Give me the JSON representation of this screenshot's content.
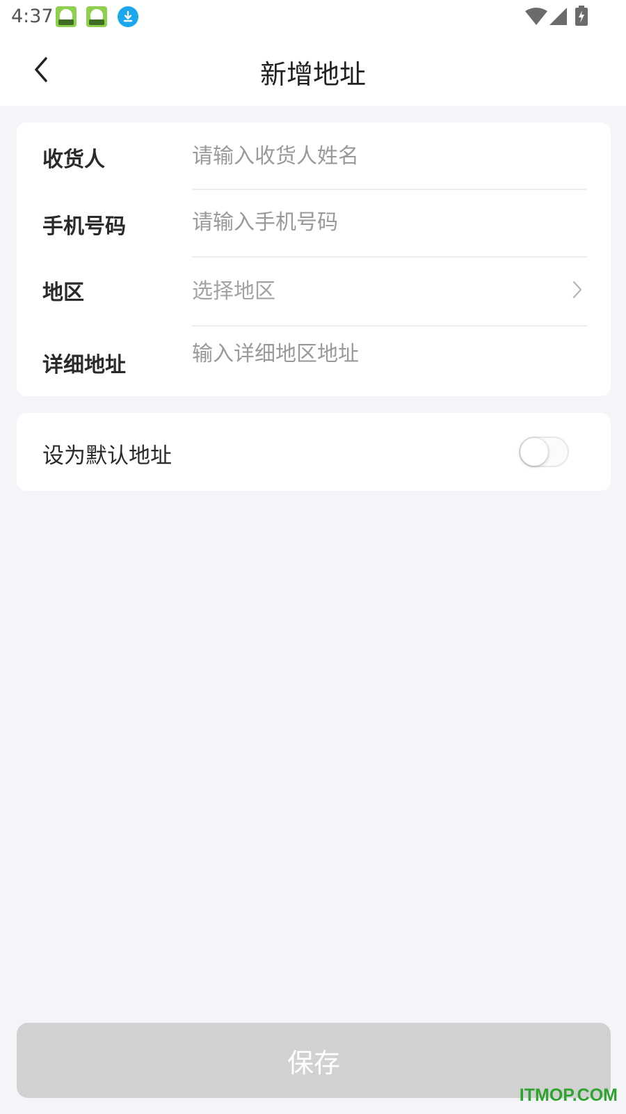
{
  "status_bar": {
    "time": "4:37",
    "icons": [
      "app-notification-icon",
      "app-notification-icon",
      "download-icon",
      "wifi-icon",
      "signal-icon",
      "battery-charging-icon"
    ]
  },
  "header": {
    "title": "新增地址",
    "back_icon": "chevron-left-icon"
  },
  "form": {
    "receiver": {
      "label": "收货人",
      "value": "",
      "placeholder": "请输入收货人姓名"
    },
    "phone": {
      "label": "手机号码",
      "value": "",
      "placeholder": "请输入手机号码"
    },
    "region": {
      "label": "地区",
      "value": "选择地区"
    },
    "address": {
      "label": "详细地址",
      "value": "",
      "placeholder": "输入详细地区地址"
    }
  },
  "default_setting": {
    "label": "设为默认地址",
    "enabled": false
  },
  "save_button": {
    "label": "保存"
  },
  "watermark": "ITMOP.COM",
  "colors": {
    "page_background": "#f4f5f9",
    "card_background": "#ffffff",
    "save_button_disabled": "#d1d1d1",
    "placeholder_text": "#9a9a9a",
    "watermark": "#2fa32f"
  }
}
